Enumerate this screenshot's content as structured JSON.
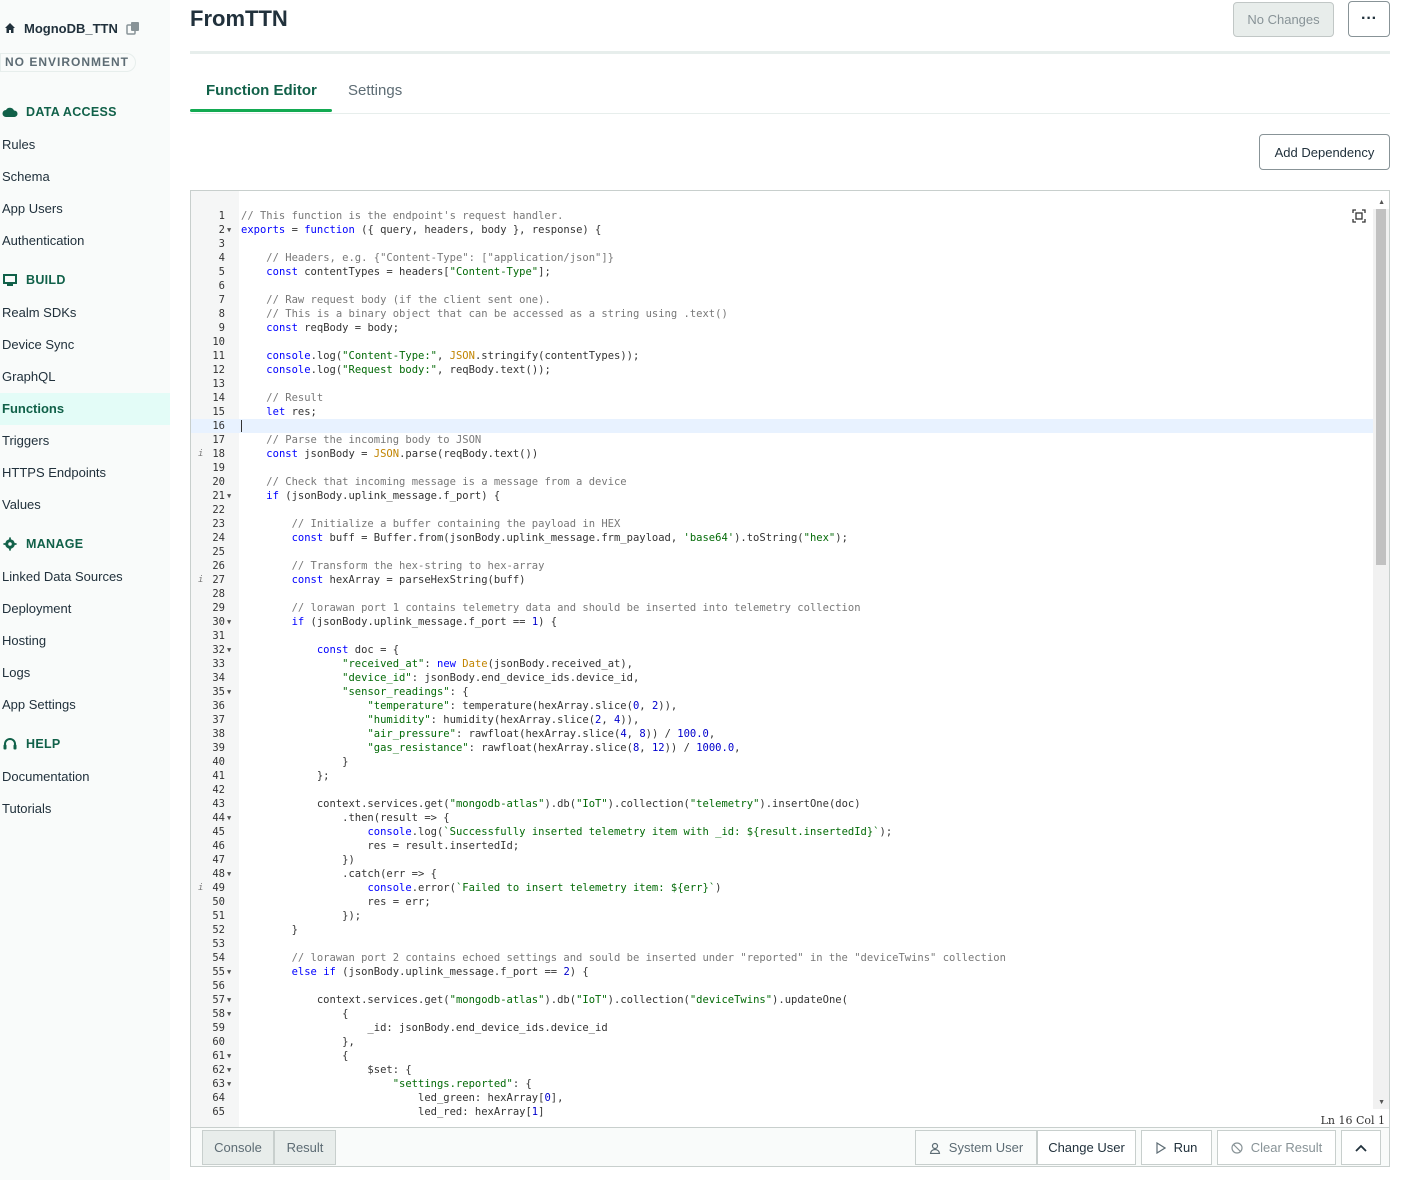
{
  "app": {
    "name": "MognoDB_TTN",
    "environment": "NO ENVIRONMENT"
  },
  "sidebar": {
    "sections": [
      {
        "title": "DATA ACCESS",
        "icon": "cloud-icon",
        "items": [
          "Rules",
          "Schema",
          "App Users",
          "Authentication"
        ]
      },
      {
        "title": "BUILD",
        "icon": "monitor-icon",
        "items": [
          "Realm SDKs",
          "Device Sync",
          "GraphQL",
          "Functions",
          "Triggers",
          "HTTPS Endpoints",
          "Values"
        ]
      },
      {
        "title": "MANAGE",
        "icon": "gear-icon",
        "items": [
          "Linked Data Sources",
          "Deployment",
          "Hosting",
          "Logs",
          "App Settings"
        ]
      },
      {
        "title": "HELP",
        "icon": "headset-icon",
        "items": [
          "Documentation",
          "Tutorials"
        ]
      }
    ],
    "active_item": "Functions"
  },
  "header": {
    "title": "FromTTN",
    "no_changes_label": "No Changes",
    "more_label": "···"
  },
  "tabs": [
    {
      "label": "Function Editor",
      "active": true
    },
    {
      "label": "Settings",
      "active": false
    }
  ],
  "add_dependency_label": "Add Dependency",
  "editor": {
    "cursor_line": 16,
    "status": "Ln 16 Col 1",
    "fold_lines": [
      2,
      21,
      30,
      32,
      35,
      44,
      48,
      55,
      57,
      58,
      61,
      62,
      63
    ],
    "info_lines": [
      18,
      27,
      49
    ],
    "lines": [
      "// This function is the endpoint's request handler.",
      "exports = function ({ query, headers, body }, response) {",
      "",
      "    // Headers, e.g. {\"Content-Type\": [\"application/json\"]}",
      "    const contentTypes = headers[\"Content-Type\"];",
      "",
      "    // Raw request body (if the client sent one).",
      "    // This is a binary object that can be accessed as a string using .text()",
      "    const reqBody = body;",
      "",
      "    console.log(\"Content-Type:\", JSON.stringify(contentTypes));",
      "    console.log(\"Request body:\", reqBody.text());",
      "",
      "    // Result",
      "    let res;",
      "",
      "    // Parse the incoming body to JSON",
      "    const jsonBody = JSON.parse(reqBody.text())",
      "",
      "    // Check that incoming message is a message from a device",
      "    if (jsonBody.uplink_message.f_port) {",
      "",
      "        // Initialize a buffer containing the payload in HEX",
      "        const buff = Buffer.from(jsonBody.uplink_message.frm_payload, 'base64').toString(\"hex\");",
      "",
      "        // Transform the hex-string to hex-array",
      "        const hexArray = parseHexString(buff)",
      "",
      "        // lorawan port 1 contains telemetry data and should be inserted into telemetry collection",
      "        if (jsonBody.uplink_message.f_port == 1) {",
      "",
      "            const doc = {",
      "                \"received_at\": new Date(jsonBody.received_at),",
      "                \"device_id\": jsonBody.end_device_ids.device_id,",
      "                \"sensor_readings\": {",
      "                    \"temperature\": temperature(hexArray.slice(0, 2)),",
      "                    \"humidity\": humidity(hexArray.slice(2, 4)),",
      "                    \"air_pressure\": rawfloat(hexArray.slice(4, 8)) / 100.0,",
      "                    \"gas_resistance\": rawfloat(hexArray.slice(8, 12)) / 1000.0,",
      "                }",
      "            };",
      "",
      "            context.services.get(\"mongodb-atlas\").db(\"IoT\").collection(\"telemetry\").insertOne(doc)",
      "                .then(result => {",
      "                    console.log(`Successfully inserted telemetry item with _id: ${result.insertedId}`);",
      "                    res = result.insertedId;",
      "                })",
      "                .catch(err => {",
      "                    console.error(`Failed to insert telemetry item: ${err}`)",
      "                    res = err;",
      "                });",
      "        }",
      "",
      "        // lorawan port 2 contains echoed settings and sould be inserted under \"reported\" in the \"deviceTwins\" collection",
      "        else if (jsonBody.uplink_message.f_port == 2) {",
      "",
      "            context.services.get(\"mongodb-atlas\").db(\"IoT\").collection(\"deviceTwins\").updateOne(",
      "                {",
      "                    _id: jsonBody.end_device_ids.device_id",
      "                },",
      "                {",
      "                    $set: {",
      "                        \"settings.reported\": {",
      "                            led_green: hexArray[0],",
      "                            led_red: hexArray[1]"
    ]
  },
  "bottom": {
    "console_tab": "Console",
    "result_tab": "Result",
    "system_user": "System User",
    "change_user": "Change User",
    "run": "Run",
    "clear_result": "Clear Result"
  },
  "colors": {
    "accent": "#13aa52",
    "active_text": "#116149",
    "active_bg": "#e3fcf7"
  }
}
